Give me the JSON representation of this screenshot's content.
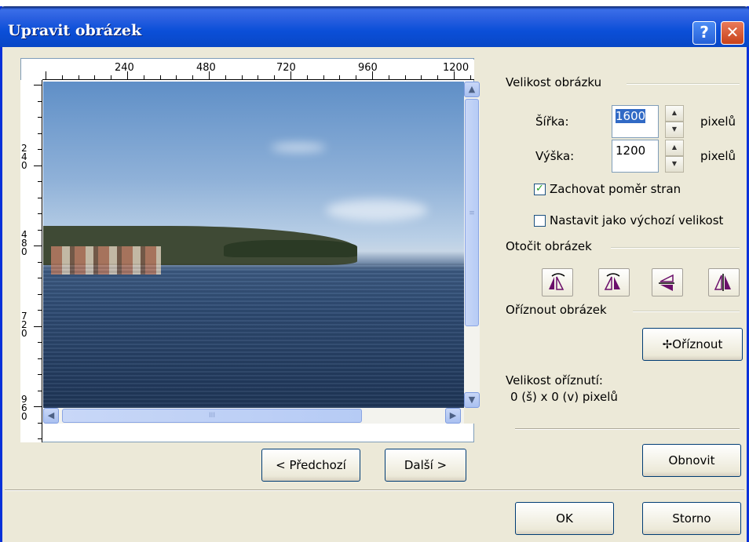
{
  "window": {
    "title": "Upravit obrázek",
    "help_label": "?",
    "close_label": "✕"
  },
  "ruler": {
    "top_labels": [
      "240",
      "480",
      "720",
      "960",
      "1200"
    ],
    "left_labels": [
      "240",
      "480",
      "720",
      "960"
    ]
  },
  "preview": {
    "thumb_grip": "III"
  },
  "size_group": {
    "title": "Velikost obrázku",
    "width_label": "Šířka:",
    "width_value": "1600",
    "height_label": "Výška:",
    "height_value": "1200",
    "unit": "pixelů",
    "keep_ratio_label": "Zachovat poměr stran",
    "keep_ratio_checked": true,
    "default_size_label": "Nastavit jako výchozí velikost",
    "default_size_checked": false
  },
  "rotate_group": {
    "title": "Otočit obrázek",
    "buttons": [
      "rotate-left-icon",
      "rotate-right-icon",
      "flip-vertical-icon",
      "flip-horizontal-icon"
    ]
  },
  "crop_group": {
    "title": "Oříznout obrázek",
    "crop_button": "Oříznout",
    "size_caption": "Velikost oříznutí:",
    "size_value": "0 (š) x 0 (v) pixelů"
  },
  "nav": {
    "prev": "< Předchozí",
    "next": "Další >"
  },
  "actions": {
    "reset": "Obnovit",
    "ok": "OK",
    "cancel": "Storno"
  },
  "colors": {
    "titlebar": "#0b4fd8",
    "dialog_bg": "#ece9d8",
    "icon_accent": "#6b0f6b"
  }
}
